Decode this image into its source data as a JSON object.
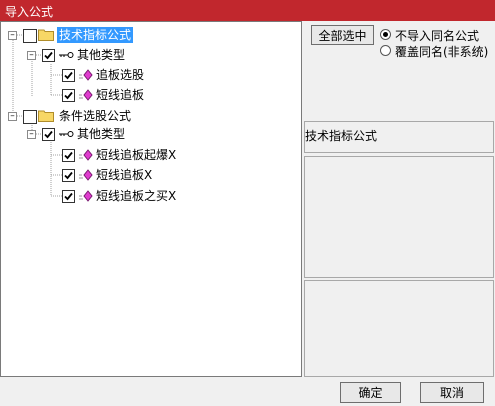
{
  "window": {
    "title": "导入公式"
  },
  "tree": {
    "groups": [
      {
        "label": "技术指标公式",
        "subgroup": {
          "label": "其他类型",
          "items": [
            "追板选股",
            "短线追板"
          ]
        }
      },
      {
        "label": "条件选股公式",
        "subgroup": {
          "label": "其他类型",
          "items": [
            "短线追板起爆X",
            "短线追板X",
            "短线追板之买X"
          ]
        }
      }
    ]
  },
  "options": {
    "select_all_label": "全部选中",
    "radio_no_import": "不导入同名公式",
    "radio_overwrite": "覆盖同名(非系统)",
    "selected": "no_import"
  },
  "preview": {
    "title": "技术指标公式"
  },
  "footer": {
    "ok_label": "确定",
    "cancel_label": "取消"
  }
}
